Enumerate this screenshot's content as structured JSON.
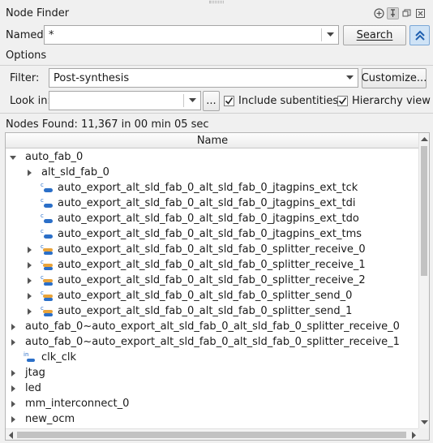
{
  "window": {
    "title": "Node Finder",
    "icons": [
      "add-icon",
      "pin-icon",
      "restore-icon",
      "close-icon"
    ]
  },
  "named": {
    "label": "Named:",
    "value": "*",
    "search_label": "Search",
    "collapse_icon": "double-chevron-up-icon"
  },
  "options": {
    "label": "Options",
    "filter_label": "Filter:",
    "filter_value": "Post-synthesis",
    "customize_label": "Customize...",
    "lookin_label": "Look in:",
    "lookin_value": "",
    "browse_label": "...",
    "include_subentities": {
      "label": "Include subentities",
      "checked": true
    },
    "hierarchy_view": {
      "label": "Hierarchy view",
      "checked": true
    }
  },
  "status": "Nodes Found: 11,367 in 00 min 05 sec",
  "tree": {
    "column_header": "Name",
    "rows": [
      {
        "label": "auto_fab_0",
        "level": 0,
        "expander": "expanded",
        "icon": ""
      },
      {
        "label": "alt_sld_fab_0",
        "level": 1,
        "expander": "collapsed",
        "icon": ""
      },
      {
        "label": "auto_export_alt_sld_fab_0_alt_sld_fab_0_jtagpins_ext_tck",
        "level": 1,
        "expander": "none",
        "icon": "combinational-node-icon"
      },
      {
        "label": "auto_export_alt_sld_fab_0_alt_sld_fab_0_jtagpins_ext_tdi",
        "level": 1,
        "expander": "none",
        "icon": "combinational-node-icon"
      },
      {
        "label": "auto_export_alt_sld_fab_0_alt_sld_fab_0_jtagpins_ext_tdo",
        "level": 1,
        "expander": "none",
        "icon": "combinational-node-icon"
      },
      {
        "label": "auto_export_alt_sld_fab_0_alt_sld_fab_0_jtagpins_ext_tms",
        "level": 1,
        "expander": "none",
        "icon": "combinational-node-icon"
      },
      {
        "label": "auto_export_alt_sld_fab_0_alt_sld_fab_0_splitter_receive_0",
        "level": 1,
        "expander": "collapsed",
        "icon": "bus-node-icon"
      },
      {
        "label": "auto_export_alt_sld_fab_0_alt_sld_fab_0_splitter_receive_1",
        "level": 1,
        "expander": "collapsed",
        "icon": "bus-node-icon"
      },
      {
        "label": "auto_export_alt_sld_fab_0_alt_sld_fab_0_splitter_receive_2",
        "level": 1,
        "expander": "collapsed",
        "icon": "bus-node-icon"
      },
      {
        "label": "auto_export_alt_sld_fab_0_alt_sld_fab_0_splitter_send_0",
        "level": 1,
        "expander": "collapsed",
        "icon": "bus-node-icon"
      },
      {
        "label": "auto_export_alt_sld_fab_0_alt_sld_fab_0_splitter_send_1",
        "level": 1,
        "expander": "collapsed",
        "icon": "bus-node-icon"
      },
      {
        "label": "auto_fab_0~auto_export_alt_sld_fab_0_alt_sld_fab_0_splitter_receive_0",
        "level": 0,
        "expander": "collapsed",
        "icon": ""
      },
      {
        "label": "auto_fab_0~auto_export_alt_sld_fab_0_alt_sld_fab_0_splitter_receive_1",
        "level": 0,
        "expander": "collapsed",
        "icon": ""
      },
      {
        "label": "clk_clk",
        "level": 0,
        "expander": "none",
        "icon": "input-pin-icon"
      },
      {
        "label": "jtag",
        "level": 0,
        "expander": "collapsed",
        "icon": ""
      },
      {
        "label": "led",
        "level": 0,
        "expander": "collapsed",
        "icon": ""
      },
      {
        "label": "mm_interconnect_0",
        "level": 0,
        "expander": "collapsed",
        "icon": ""
      },
      {
        "label": "new_ocm",
        "level": 0,
        "expander": "collapsed",
        "icon": ""
      }
    ]
  },
  "colors": {
    "accent_blue": "#2b6fc8",
    "pressed_bg": "#cfe3f6"
  }
}
